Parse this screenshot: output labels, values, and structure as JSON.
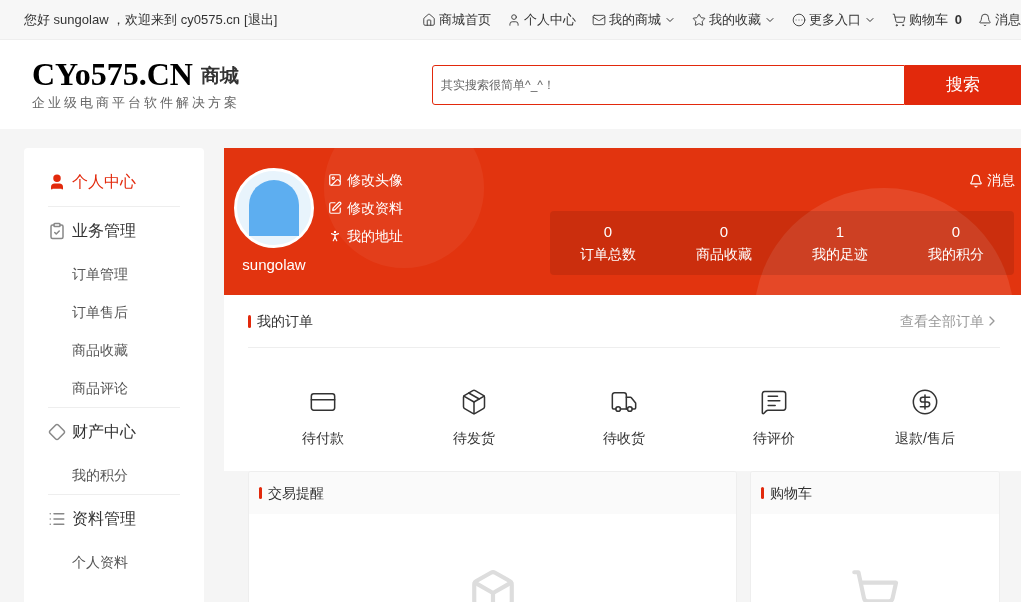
{
  "topbar": {
    "greeting": "您好 sungolaw ，欢迎来到 cy0575.cn",
    "logout": "[退出]",
    "links": [
      {
        "kind": "home",
        "label": "商城首页",
        "dropdown": false
      },
      {
        "kind": "user",
        "label": "个人中心",
        "dropdown": false
      },
      {
        "kind": "mail",
        "label": "我的商城",
        "dropdown": true
      },
      {
        "kind": "star",
        "label": "我的收藏",
        "dropdown": true
      },
      {
        "kind": "more",
        "label": "更多入口",
        "dropdown": true
      },
      {
        "kind": "cart",
        "label": "购物车",
        "count": "0",
        "dropdown": false
      },
      {
        "kind": "bell",
        "label": "消息",
        "dropdown": false
      }
    ]
  },
  "header": {
    "logo": "CYo575.CN",
    "logo_suffix": "商城",
    "slogan": "企业级电商平台软件解决方案",
    "search": {
      "placeholder": "其实搜索很简单^_^！",
      "button": "搜索"
    }
  },
  "sidebar": {
    "sections": [
      {
        "kind": "person",
        "title": "个人中心",
        "selected": true
      },
      {
        "kind": "clipboard",
        "title": "业务管理",
        "selected": false,
        "items": [
          "订单管理",
          "订单售后",
          "商品收藏",
          "商品评论"
        ]
      },
      {
        "kind": "diamond",
        "title": "财产中心",
        "selected": false,
        "items": [
          "我的积分"
        ]
      },
      {
        "kind": "list",
        "title": "资料管理",
        "selected": false,
        "items": [
          "个人资料"
        ]
      }
    ]
  },
  "profile": {
    "username": "sungolaw",
    "actions": [
      {
        "kind": "photo",
        "label": "修改头像"
      },
      {
        "kind": "edit",
        "label": "修改资料"
      },
      {
        "kind": "pin",
        "label": "我的地址"
      }
    ],
    "messages": "消息",
    "stats": [
      {
        "value": "0",
        "label": "订单总数"
      },
      {
        "value": "0",
        "label": "商品收藏"
      },
      {
        "value": "1",
        "label": "我的足迹"
      },
      {
        "value": "0",
        "label": "我的积分"
      }
    ]
  },
  "orders": {
    "title": "我的订单",
    "view_all": "查看全部订单",
    "statuses": [
      {
        "kind": "pay",
        "label": "待付款"
      },
      {
        "kind": "ship",
        "label": "待发货"
      },
      {
        "kind": "truck",
        "label": "待收货"
      },
      {
        "kind": "comment",
        "label": "待评价"
      },
      {
        "kind": "refund",
        "label": "退款/售后"
      }
    ]
  },
  "panels": [
    {
      "kind": "box",
      "title": "交易提醒"
    },
    {
      "kind": "cart",
      "title": "购物车"
    }
  ]
}
